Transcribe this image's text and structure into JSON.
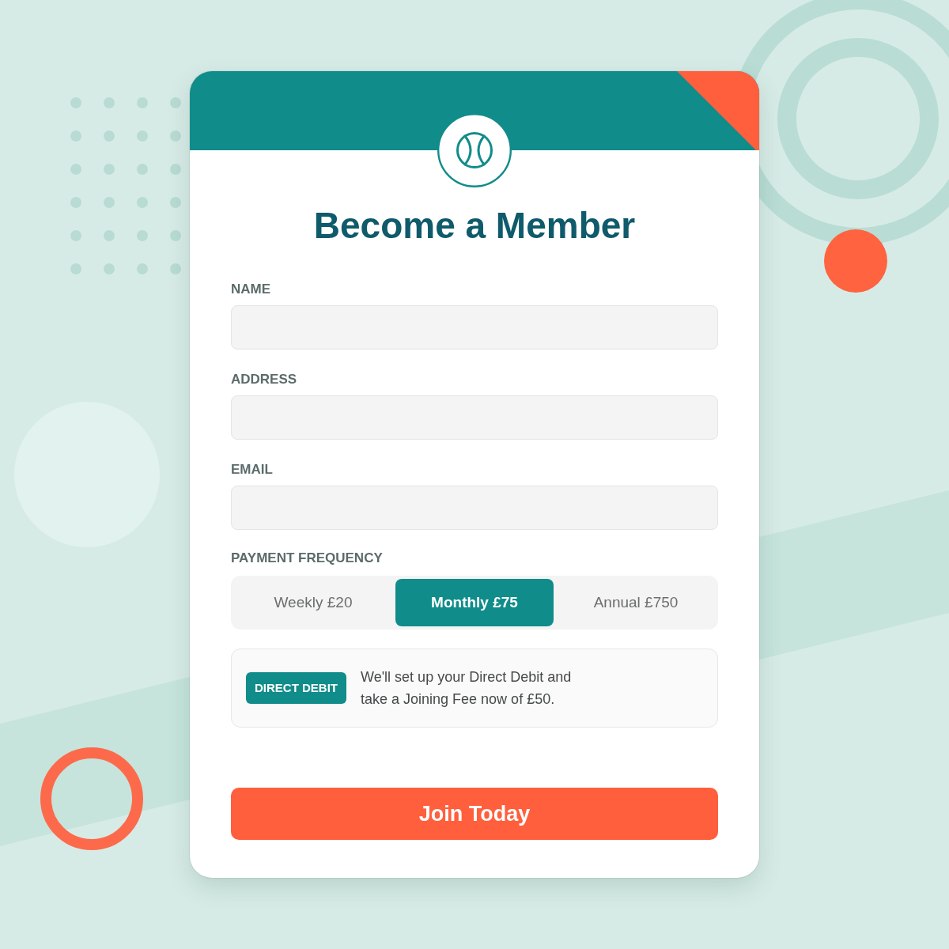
{
  "header": {
    "title": "Become a Member"
  },
  "fields": [
    {
      "label": "NAME"
    },
    {
      "label": "ADDRESS"
    },
    {
      "label": "EMAIL"
    }
  ],
  "payment_frequency": {
    "label": "PAYMENT FREQUENCY",
    "options": [
      {
        "label": "Weekly £20",
        "selected": false
      },
      {
        "label": "Monthly £75",
        "selected": true
      },
      {
        "label": "Annual £750",
        "selected": false
      }
    ]
  },
  "notice": {
    "badge": "DIRECT DEBIT",
    "text": "We'll set up your Direct Debit and take a Joining Fee now of £50."
  },
  "submit_button": {
    "label": "Join Today"
  }
}
